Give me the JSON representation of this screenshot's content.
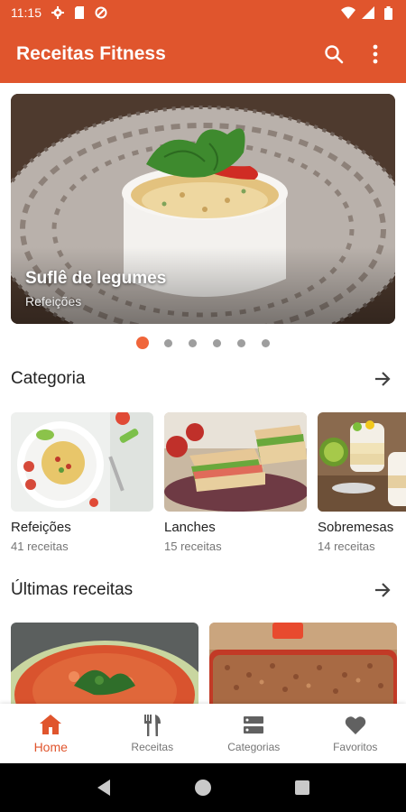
{
  "status_bar": {
    "time": "11:15",
    "icons_left": [
      "gear-icon",
      "sd-card-icon",
      "no-data-saver-icon"
    ],
    "icons_right": [
      "wifi-icon",
      "signal-icon",
      "battery-icon"
    ]
  },
  "app_bar": {
    "title": "Receitas Fitness",
    "actions": [
      "search-icon",
      "more-vert-icon"
    ]
  },
  "hero": {
    "title": "Suflê de legumes",
    "subtitle": "Refeições",
    "slide_count": 6,
    "active_slide": 0
  },
  "categories": {
    "title": "Categoria",
    "items": [
      {
        "name": "Refeições",
        "count": "41 receitas"
      },
      {
        "name": "Lanches",
        "count": "15 receitas"
      },
      {
        "name": "Sobremesas",
        "count": "14 receitas"
      }
    ]
  },
  "latest": {
    "title": "Últimas receitas"
  },
  "bottom_nav": {
    "items": [
      {
        "label": "Home",
        "icon": "home-icon",
        "active": true
      },
      {
        "label": "Receitas",
        "icon": "fork-knife-icon",
        "active": false
      },
      {
        "label": "Categorias",
        "icon": "categories-icon",
        "active": false
      },
      {
        "label": "Favoritos",
        "icon": "heart-icon",
        "active": false
      }
    ]
  },
  "colors": {
    "primary": "#e0552d",
    "accent": "#f0653a",
    "text": "#212121",
    "muted": "#757575"
  }
}
